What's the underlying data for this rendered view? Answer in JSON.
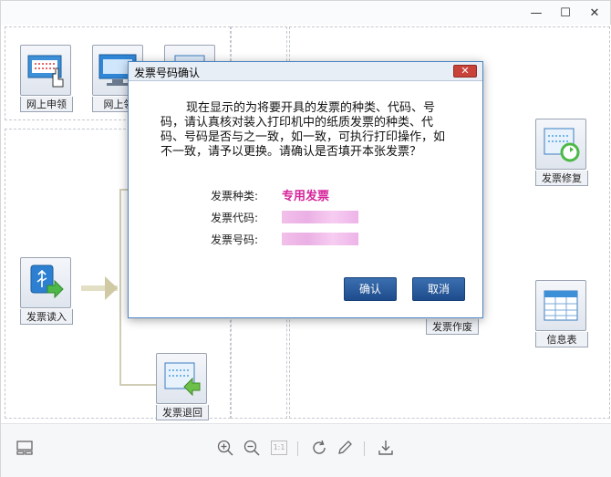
{
  "window": {
    "controls": {
      "minimize": "—",
      "maximize": "☐",
      "close": "✕"
    }
  },
  "tiles": {
    "online_apply": "网上申领",
    "online_collect": "网上领",
    "invoice_read": "发票读入",
    "invoice_return": "发票退回",
    "invoice_repair": "发票修复",
    "invoice_void": "发票作废",
    "info_table": "信息表"
  },
  "dialog": {
    "title": "发票号码确认",
    "close_label": "✕",
    "message": "现在显示的为将要开具的发票的种类、代码、号码，请认真核对装入打印机中的纸质发票的种类、代码、号码是否与之一致，如一致，可执行打印操作，如不一致，请予以更换。请确认是否填开本张发票？",
    "fields": {
      "type_label": "发票种类:",
      "type_value": "专用发票",
      "code_label": "发票代码:",
      "number_label": "发票号码:"
    },
    "confirm_label": "确认",
    "cancel_label": "取消"
  },
  "toolbar": {
    "icons": [
      "layout-icon",
      "zoom-in-icon",
      "zoom-out-icon",
      "actual-size-icon",
      "rotate-icon",
      "edit-icon",
      "download-icon"
    ],
    "actual_size_label": "1:1"
  },
  "colors": {
    "accent": "#1e4c8c",
    "highlight_value": "#d6249a",
    "dialog_border": "#4a84c2"
  }
}
